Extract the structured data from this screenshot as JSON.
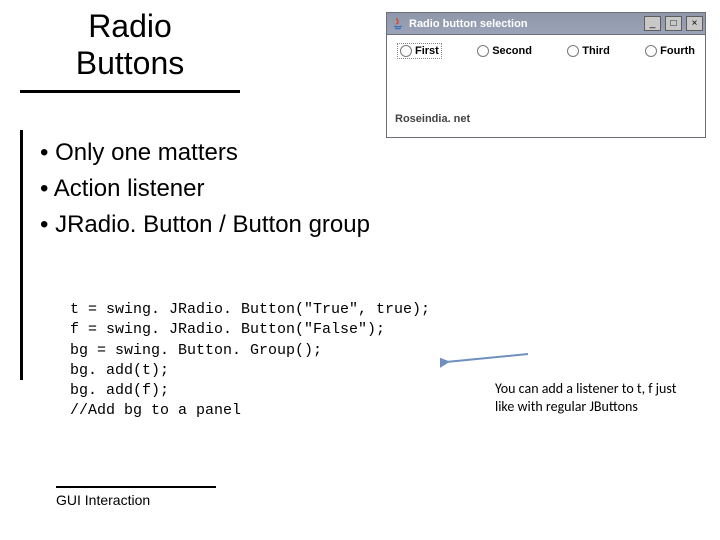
{
  "slide": {
    "title": "Radio\nButtons",
    "bullets": [
      "Only one matters",
      "Action listener",
      "JRadio. Button / Button group"
    ],
    "code": "t = swing. JRadio. Button(\"True\", true);\nf = swing. JRadio. Button(\"False\");\nbg = swing. Button. Group();\nbg. add(t);\nbg. add(f);\n//Add bg to a panel",
    "callout": "You can add a listener to t, f just like with regular JButtons",
    "footer": "GUI Interaction"
  },
  "java_window": {
    "title": "Radio button selection",
    "options": [
      "First",
      "Second",
      "Third",
      "Fourth"
    ],
    "attribution": "Roseindia. net"
  }
}
